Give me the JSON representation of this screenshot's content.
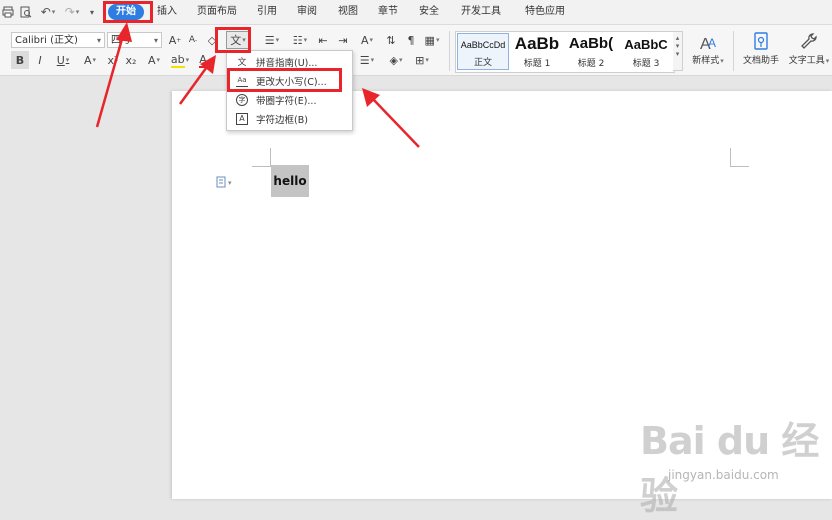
{
  "menubar": {
    "tabs": [
      {
        "label": "开始",
        "active": true
      },
      {
        "label": "插入"
      },
      {
        "label": "页面布局"
      },
      {
        "label": "引用"
      },
      {
        "label": "审阅"
      },
      {
        "label": "视图"
      },
      {
        "label": "章节"
      },
      {
        "label": "安全"
      },
      {
        "label": "开发工具"
      },
      {
        "label": "特色应用"
      }
    ]
  },
  "ribbon": {
    "font_name": "Calibri (正文)",
    "font_size": "四号",
    "phonetic_button_glyph": "文",
    "styles": [
      {
        "sample": "AaBbCcDd",
        "label": "正文"
      },
      {
        "sample": "AaBb",
        "label": "标题 1"
      },
      {
        "sample": "AaBb(",
        "label": "标题 2"
      },
      {
        "sample": "AaBbC",
        "label": "标题 3"
      }
    ],
    "new_style_label": "新样式",
    "doc_assistant_label": "文档助手",
    "text_tool_label": "文字工具"
  },
  "font_menu": {
    "items": [
      {
        "icon": "pinyin-icon",
        "glyph": "文",
        "label": "拼音指南(U)..."
      },
      {
        "icon": "change-case-icon",
        "glyph": "Aa",
        "label": "更改大小写(C)..."
      },
      {
        "icon": "enclosed-char-icon",
        "glyph": "字",
        "label": "带圈字符(E)..."
      },
      {
        "icon": "char-border-icon",
        "glyph": "A",
        "label": "字符边框(B)"
      }
    ]
  },
  "document": {
    "text": "hello"
  },
  "colors": {
    "accent": "#2f7de1",
    "annotation_red": "#e8252b",
    "selection_gray": "#c4c4c4"
  },
  "watermark": {
    "brand": "Bai du 经验",
    "url": "jingyan.baidu.com"
  }
}
